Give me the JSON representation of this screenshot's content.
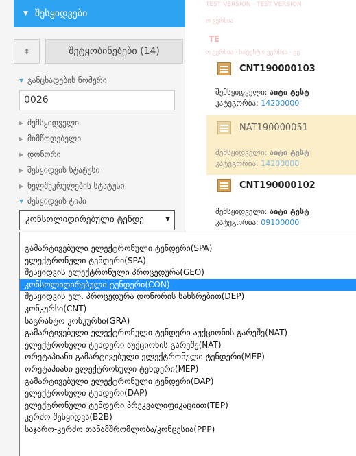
{
  "sidebar": {
    "section_title": "შესყიდვები",
    "messages_button": "შეტყობინებები (14)",
    "filters": [
      {
        "label": "განცხადების ნომერი",
        "open": true
      },
      {
        "label": "შემსყიდველი",
        "open": false
      },
      {
        "label": "მიმწოდებელი",
        "open": false
      },
      {
        "label": "დონორი",
        "open": false
      },
      {
        "label": "შესყიდვის სტატუსი",
        "open": false
      },
      {
        "label": "ხელშეკრულების სტატუსი",
        "open": false
      },
      {
        "label": "შესყიდვის ტიპი",
        "open": true
      }
    ],
    "number_value": "0026",
    "type_selected": "კონსოლიდირებული ტენდე"
  },
  "results": [
    {
      "id": "CNT190000103",
      "buyer_label": "შემსყიდველი:",
      "buyer": "აიტი ტესტ",
      "category_label": "კატეგორია:",
      "category": "14200000",
      "highlight": false
    },
    {
      "id": "NAT190000051",
      "buyer_label": "შემსყიდველი:",
      "buyer": "აიტი ტესტ",
      "category_label": "კატეგორია:",
      "category": "14200000",
      "highlight": true
    },
    {
      "id": "CNT190000102",
      "buyer_label": "შემსყიდველი:",
      "buyer": "აიტი ტესტ",
      "category_label": "კატეგორია:",
      "category": "09100000",
      "highlight": false
    }
  ],
  "dropdown_options": [
    "გამარტივებული ელექტრონული ტენდერი(SPA)",
    "ელექტრონული ტენდერი(SPA)",
    "შესყიდვის ელექტრონული პროცედურა(GEO)",
    "კონსოლიდირებული ტენდერი(CON)",
    "შესყიდვის ელ. პროცედურა დონორის სახსრებით(DEP)",
    "კონკურსი(CNT)",
    "საგრანტო კონკურსი(GRA)",
    "გამარტივებული ელექტრონული ტენდერი აუქციონის გარეშე(NAT)",
    "ელექტრონული ტენდერი აუქციონის გარეშე(NAT)",
    "ორეტაპიანი გამარტივებული ელექტრონული ტენდერი(MEP)",
    "ორეტაპიანი ელექტრონული ტენდერი(MEP)",
    "გამარტივებული ელექტრონული ტენდერი(DAP)",
    "ელექტრონული ტენდერი(DAP)",
    "ელექტრონული ტენდერი პრეკვალიფიკაციით(TEP)",
    "კერძო შესყიდვა(B2B)",
    "საჯარო-კერძო თანამშრომლობა/კონცესია(PPP)"
  ],
  "dropdown_selected_index": 3,
  "colors": {
    "accent": "#2ea3f2",
    "selected": "#1e90ff",
    "highlight": "#fbeec8",
    "link": "#2b8bd6"
  }
}
